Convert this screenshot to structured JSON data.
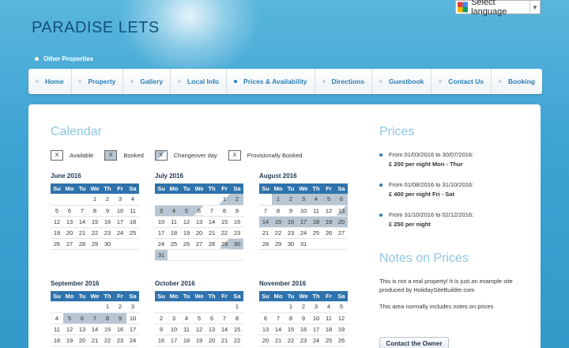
{
  "header": {
    "site_title": "PARADISE LETS",
    "language_label": "Select language"
  },
  "other_properties_link": "Other Properties",
  "nav": [
    {
      "label": "Home",
      "name": "home"
    },
    {
      "label": "Property",
      "name": "property"
    },
    {
      "label": "Gallery",
      "name": "gallery"
    },
    {
      "label": "Local Info",
      "name": "local-info"
    },
    {
      "label": "Prices & Availability",
      "name": "prices-availability",
      "active": true
    },
    {
      "label": "Directions",
      "name": "directions"
    },
    {
      "label": "Guestbook",
      "name": "guestbook"
    },
    {
      "label": "Contact Us",
      "name": "contact-us"
    },
    {
      "label": "Booking",
      "name": "booking"
    }
  ],
  "calendar": {
    "heading": "Calendar",
    "legend": [
      {
        "mark": "X",
        "label": "Available",
        "kind": "available"
      },
      {
        "mark": "X",
        "label": "Booked",
        "kind": "booked"
      },
      {
        "mark": "X",
        "label": "Changeover day",
        "kind": "change"
      },
      {
        "mark": "X",
        "label": "Provisionally Booked",
        "kind": "provisional"
      }
    ],
    "weekdays": [
      "Su",
      "Mo",
      "Tu",
      "We",
      "Th",
      "Fr",
      "Sa"
    ],
    "months": [
      {
        "title": "June 2016",
        "weeks": [
          [
            "",
            "",
            "",
            "1",
            "2",
            "3",
            "4"
          ],
          [
            "5",
            "6",
            "7",
            "8",
            "9",
            "10",
            "11"
          ],
          [
            "12",
            "13",
            "14",
            "15",
            "16",
            "17",
            "18"
          ],
          [
            "19",
            "20",
            "21",
            "22",
            "23",
            "24",
            "25"
          ],
          [
            "26",
            "27",
            "28",
            "29",
            "30",
            "",
            ""
          ]
        ],
        "states": {}
      },
      {
        "title": "July 2016",
        "weeks": [
          [
            "",
            "",
            "",
            "",
            "",
            "1",
            "2"
          ],
          [
            "3",
            "4",
            "5",
            "6",
            "7",
            "8",
            "9"
          ],
          [
            "10",
            "11",
            "12",
            "13",
            "14",
            "15",
            "16"
          ],
          [
            "17",
            "18",
            "19",
            "20",
            "21",
            "22",
            "23"
          ],
          [
            "24",
            "25",
            "26",
            "27",
            "28",
            "29",
            "30"
          ],
          [
            "31",
            "",
            "",
            "",
            "",
            "",
            ""
          ]
        ],
        "states": {
          "1": "co",
          "2": "bk",
          "3": "bk",
          "4": "bk",
          "5": "bk",
          "6": "ci",
          "29": "co",
          "30": "bk",
          "31": "bk"
        }
      },
      {
        "title": "August 2016",
        "weeks": [
          [
            "",
            "1",
            "2",
            "3",
            "4",
            "5",
            "6"
          ],
          [
            "7",
            "8",
            "9",
            "10",
            "11",
            "12",
            "13"
          ],
          [
            "14",
            "15",
            "16",
            "17",
            "18",
            "19",
            "20"
          ],
          [
            "21",
            "22",
            "23",
            "24",
            "25",
            "26",
            "27"
          ],
          [
            "28",
            "29",
            "30",
            "31",
            "",
            "",
            ""
          ]
        ],
        "states": {
          "1": "bk",
          "2": "bk",
          "3": "bk",
          "4": "bk",
          "5": "bk",
          "6": "bk",
          "13": "co",
          "14": "bk",
          "15": "bk",
          "16": "bk",
          "17": "bk",
          "18": "bk",
          "19": "bk",
          "20": "bk"
        }
      },
      {
        "title": "September 2016",
        "weeks": [
          [
            "",
            "",
            "",
            "",
            "1",
            "2",
            "3"
          ],
          [
            "4",
            "5",
            "6",
            "7",
            "8",
            "9",
            "10"
          ],
          [
            "11",
            "12",
            "13",
            "14",
            "15",
            "16",
            "17"
          ],
          [
            "18",
            "19",
            "20",
            "21",
            "22",
            "23",
            "24"
          ]
        ],
        "states": {
          "5": "bk",
          "6": "bk",
          "7": "bk",
          "8": "bk",
          "9": "bk"
        }
      },
      {
        "title": "October 2016",
        "weeks": [
          [
            "",
            "",
            "",
            "",
            "",
            "",
            "1"
          ],
          [
            "2",
            "3",
            "4",
            "5",
            "6",
            "7",
            "8"
          ],
          [
            "9",
            "10",
            "11",
            "12",
            "13",
            "14",
            "15"
          ],
          [
            "16",
            "17",
            "18",
            "19",
            "20",
            "21",
            "22"
          ]
        ],
        "states": {}
      },
      {
        "title": "November 2016",
        "weeks": [
          [
            "",
            "",
            "1",
            "2",
            "3",
            "4",
            "5"
          ],
          [
            "6",
            "7",
            "8",
            "9",
            "10",
            "11",
            "12"
          ],
          [
            "13",
            "14",
            "15",
            "16",
            "17",
            "18",
            "19"
          ],
          [
            "20",
            "21",
            "22",
            "23",
            "24",
            "25",
            "26"
          ]
        ],
        "states": {}
      }
    ]
  },
  "prices": {
    "heading": "Prices",
    "items": [
      {
        "range": "From 01/03/2016 to 30/07/2016:",
        "amount": "£ 200 per night Mon - Thur"
      },
      {
        "range": "From 01/08/2016 to 31/10/2016:",
        "amount": "£ 400 per night Fri - Sat"
      },
      {
        "range": "From 31/10/2016 to 02/12/2016:",
        "amount": "£ 250 per night"
      }
    ]
  },
  "notes": {
    "heading": "Notes on Prices",
    "paragraphs": [
      "This is not a real property! It is just an example site produced by HolidaySiteBuilder.com",
      "This area normally includes notes on prices"
    ],
    "contact_button": "Contact the Owner"
  }
}
